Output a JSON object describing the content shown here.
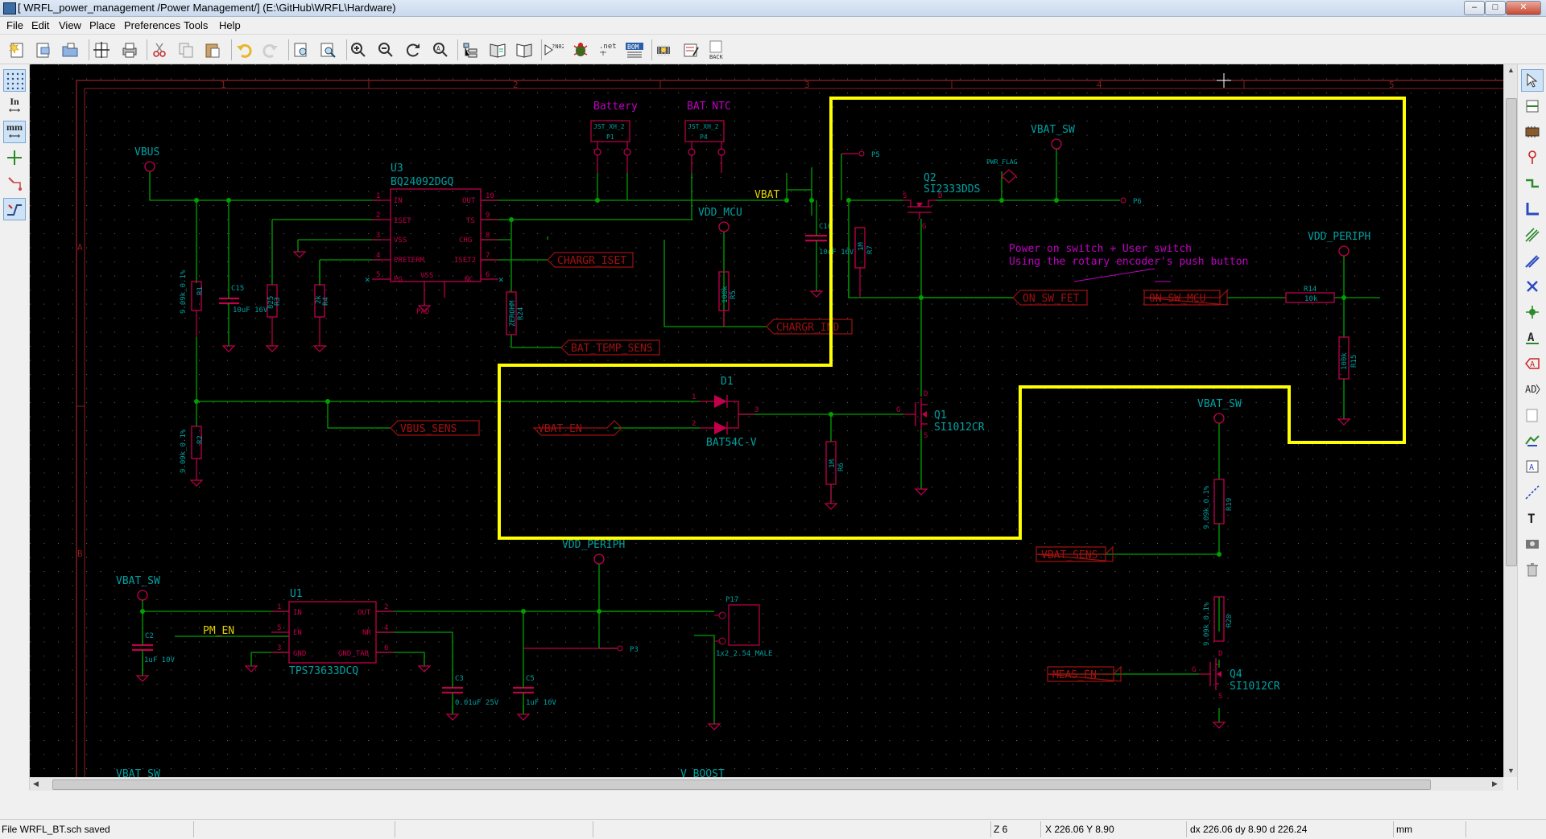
{
  "window": {
    "title": "[ WRFL_power_management /Power Management/] (E:\\GitHub\\WRFL\\Hardware)",
    "minimize_label": "–",
    "maximize_label": "□",
    "close_label": "✕"
  },
  "menubar": {
    "items": [
      "File",
      "Edit",
      "View",
      "Place",
      "Preferences",
      "Tools",
      "Help"
    ]
  },
  "toolbar": {
    "icons": [
      "new-sheet-icon",
      "sheet-hierarchy-icon",
      "open-icon",
      "page-settings-icon",
      "print-icon",
      "cut-icon",
      "copy-icon",
      "paste-icon",
      "undo-icon",
      "redo-icon",
      "find-icon",
      "find-replace-icon",
      "zoom-in-icon",
      "zoom-out-icon",
      "redraw-icon",
      "zoom-fit-icon",
      "hierarchy-navigator-icon",
      "library-editor-icon",
      "library-browser-icon",
      "annotate-icon",
      "erc-icon",
      "netlist-icon",
      "bom-icon",
      "cvpcb-icon",
      "pcbnew-icon",
      "back-icon"
    ],
    "annotate_label": "?N02",
    "netlist_label": ".net",
    "bom_label": "BOM",
    "back_label": "BACK"
  },
  "left_toolbar": {
    "inch_label": "In",
    "mm_label": "mm"
  },
  "schematic": {
    "col_labels": [
      "1",
      "2",
      "3",
      "4",
      "5"
    ],
    "row_labels": [
      "A",
      "B"
    ],
    "power_ports": {
      "vbus": "VBUS",
      "vbat_sw_q2": "VBAT_SW",
      "vdd_mcu": "VDD_MCU",
      "vdd_periph_top": "VDD_PERIPH",
      "vbat_sw_right": "VBAT_SW",
      "vbat_sw_u1": "VBAT_SW",
      "vdd_periph_u1": "VDD_PERIPH",
      "vbat_sw_bottom": "VBAT_SW",
      "v_boost": "V_BOOST"
    },
    "net_labels": {
      "vbat": "VBAT",
      "pm_en": "PM_EN"
    },
    "global_labels": {
      "chargr_iset": "CHARGR_ISET",
      "chargr_ind": "CHARGR_IND",
      "bat_temp_sens": "BAT_TEMP_SENS",
      "vbus_sens": "VBUS_SENS",
      "vbat_en": "VBAT_EN",
      "on_sw_fet": "ON_SW_FET",
      "on_sw_mcu": "ON_SW_MCU",
      "vbat_sens": "VBAT_SENS",
      "meas_en": "MEAS_EN"
    },
    "connectors": {
      "battery_title": "Battery",
      "bat_ntc_title": "BAT NTC",
      "p1_value": "JST_XH_2",
      "p1_ref": "P1",
      "p4_value": "JST_XH_2",
      "p4_ref": "P4",
      "p5": "P5",
      "p6": "P6",
      "p3": "P3",
      "p17_ref": "P17",
      "p17_value": "1x2_2.54_MALE"
    },
    "u3": {
      "ref": "U3",
      "value": "BQ24092DGQ",
      "pins_left": [
        "IN",
        "ISET",
        "VSS",
        "PRETERM",
        "PG"
      ],
      "pins_right": [
        "OUT",
        "TS",
        "CHG",
        "ISET2",
        "NC"
      ],
      "pin_nums_left": [
        "1",
        "2",
        "3",
        "4",
        "5"
      ],
      "pin_nums_right": [
        "10",
        "9",
        "8",
        "7",
        "6"
      ],
      "bottom_pins": [
        "VSS",
        "PAD"
      ]
    },
    "u1": {
      "ref": "U1",
      "value": "TPS73633DCQ",
      "pins_left": [
        "IN",
        "EN",
        "GND"
      ],
      "pins_right": [
        "OUT",
        "NR",
        "GND_TAB"
      ],
      "pin_nums_left": [
        "1",
        "5",
        "3"
      ],
      "pin_nums_right": [
        "2",
        "4",
        "6"
      ]
    },
    "q2": {
      "ref": "Q2",
      "value": "SI2333DDS",
      "pin_s": "S",
      "pin_d": "D",
      "pin_g": "G"
    },
    "q1": {
      "ref": "Q1",
      "value": "SI1012CR",
      "pin_g": "G",
      "pin_d": "D",
      "pin_s": "S"
    },
    "q4": {
      "ref": "Q4",
      "value": "SI1012CR",
      "pin_g": "G",
      "pin_d": "D",
      "pin_s": "S"
    },
    "d1": {
      "ref": "D1",
      "value": "BAT54C-V",
      "pin1": "1",
      "pin2": "2",
      "pin3": "3"
    },
    "pwr_flag": "PWR_FLAG",
    "comment_line1": "Power on switch + User switch",
    "comment_line2": "Using the rotary encoder's push button",
    "resistors": {
      "r1": {
        "ref": "R1",
        "value": "9.09k_0.1%"
      },
      "r2": {
        "ref": "R2",
        "value": "9.09k_0.1%"
      },
      "r3": {
        "ref": "R3",
        "value": "825"
      },
      "r4": {
        "ref": "R4",
        "value": "2k"
      },
      "r24": {
        "ref": "R24",
        "value": "ZEROHM"
      },
      "r5": {
        "ref": "R5",
        "value": "100k"
      },
      "r7": {
        "ref": "R7",
        "value": "1M"
      },
      "r6": {
        "ref": "R6",
        "value": "1M"
      },
      "r14": {
        "ref": "R14",
        "value": "10k"
      },
      "r15": {
        "ref": "R15",
        "value": "100k"
      },
      "r19": {
        "ref": "R19",
        "value": "9.09k_0.1%"
      },
      "r20": {
        "ref": "R20",
        "value": "9.09k_0.1%"
      }
    },
    "capacitors": {
      "c15": {
        "ref": "C15",
        "value": "10uF 16V"
      },
      "c16": {
        "ref": "C16",
        "value": "10uF 16V"
      },
      "c2": {
        "ref": "C2",
        "value": "1uF 10V"
      },
      "c3": {
        "ref": "C3",
        "value": "0.01uF 25V"
      },
      "c5": {
        "ref": "C5",
        "value": "1uF 10V"
      }
    }
  },
  "status": {
    "message": "File WRFL_BT.sch saved",
    "zoom": "Z 6",
    "coords": "X 226.06  Y 8.90",
    "delta": "dx 226.06  dy 8.90  d 226.24",
    "units": "mm"
  }
}
